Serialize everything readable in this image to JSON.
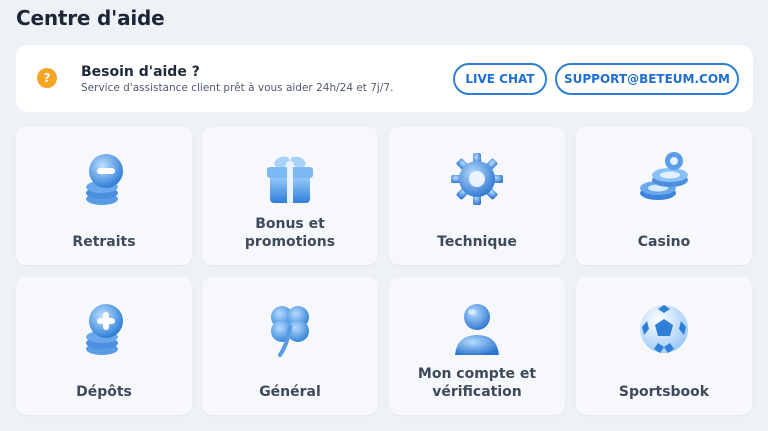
{
  "page": {
    "title": "Centre d'aide"
  },
  "banner": {
    "icon": "question-icon",
    "icon_glyph": "?",
    "title": "Besoin d'aide ?",
    "subtitle": "Service d'assistance client prêt à vous aider 24h/24 et 7j/7.",
    "chat_label": "LIVE CHAT",
    "email_label": "SUPPORT@BETEUM.COM",
    "accent": "#2f7fd8"
  },
  "categories": [
    {
      "line1": "Retraits",
      "line2": "",
      "icon": "coin-minus-icon"
    },
    {
      "line1": "Bonus et",
      "line2": "promotions",
      "icon": "gift-icon"
    },
    {
      "line1": "Technique",
      "line2": "",
      "icon": "gear-icon"
    },
    {
      "line1": "Casino",
      "line2": "",
      "icon": "casino-chips-icon"
    },
    {
      "line1": "Dépôts",
      "line2": "",
      "icon": "coin-plus-icon"
    },
    {
      "line1": "Général",
      "line2": "",
      "icon": "clover-icon"
    },
    {
      "line1": "Mon compte et",
      "line2": "vérification",
      "icon": "user-account-icon"
    },
    {
      "line1": "Sportsbook",
      "line2": "",
      "icon": "soccer-ball-icon"
    }
  ]
}
